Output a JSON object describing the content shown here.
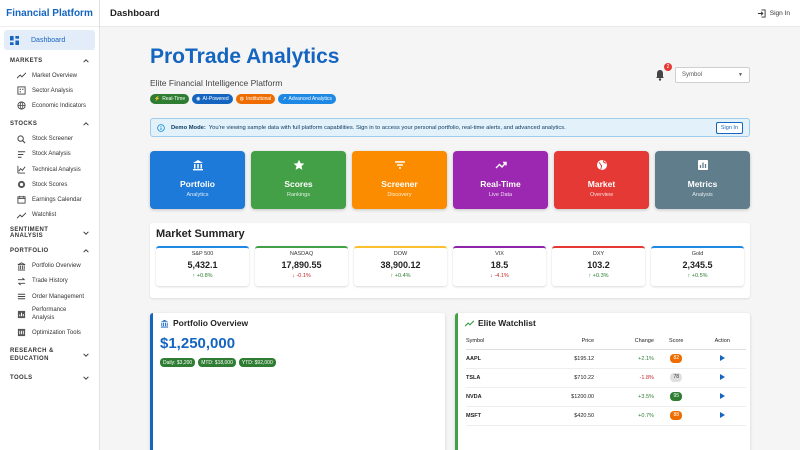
{
  "app": {
    "title": "Financial Platform"
  },
  "sidebar": {
    "active": "Dashboard",
    "sections": [
      {
        "label": "MARKETS",
        "items": [
          "Market Overview",
          "Sector Analysis",
          "Economic Indicators"
        ]
      },
      {
        "label": "STOCKS",
        "items": [
          "Stock Screener",
          "Stock Analysis",
          "Technical Analysis",
          "Stock Scores",
          "Earnings Calendar",
          "Watchlist"
        ]
      },
      {
        "label": "SENTIMENT ANALYSIS",
        "items": []
      },
      {
        "label": "PORTFOLIO",
        "items": [
          "Portfolio Overview",
          "Trade History",
          "Order Management",
          "Performance Analysis",
          "Optimization Tools"
        ]
      },
      {
        "label": "RESEARCH & EDUCATION",
        "items": []
      },
      {
        "label": "TOOLS",
        "items": []
      }
    ]
  },
  "topbar": {
    "title": "Dashboard",
    "signin": "Sign In"
  },
  "hero": {
    "title": "ProTrade Analytics",
    "subtitle": "Elite Financial Intelligence Platform",
    "badges": [
      {
        "label": "Real-Time",
        "color": "#2e7d32"
      },
      {
        "label": "AI-Powered",
        "color": "#1565c0"
      },
      {
        "label": "Institutional",
        "color": "#ef6c00"
      },
      {
        "label": "Advanced Analytics",
        "color": "#1e88e5"
      }
    ],
    "notif_count": "2",
    "symbol_placeholder": "Symbol"
  },
  "alert": {
    "title": "Demo Mode:",
    "text": "You're viewing sample data with full platform capabilities. Sign in to access your personal portfolio, real-time alerts, and advanced analytics.",
    "button": "Sign In"
  },
  "tiles": [
    {
      "title": "Portfolio",
      "sub": "Analytics",
      "color": "#1e7ad9",
      "icon": "bank-icon"
    },
    {
      "title": "Scores",
      "sub": "Rankings",
      "color": "#43a047",
      "icon": "star-icon"
    },
    {
      "title": "Screener",
      "sub": "Discovery",
      "color": "#fb8c00",
      "icon": "filter-icon"
    },
    {
      "title": "Real-Time",
      "sub": "Live Data",
      "color": "#9c27b0",
      "icon": "trending-icon"
    },
    {
      "title": "Market",
      "sub": "Overview",
      "color": "#e53935",
      "icon": "globe-icon"
    },
    {
      "title": "Metrics",
      "sub": "Analysis",
      "color": "#607d8b",
      "icon": "chart-icon"
    }
  ],
  "summary": {
    "title": "Market Summary",
    "cards": [
      {
        "name": "S&P 500",
        "value": "5,432.1",
        "change": "+0.8%",
        "dir": "up",
        "color": "#1e88e5"
      },
      {
        "name": "NASDAQ",
        "value": "17,890.55",
        "change": "-0.1%",
        "dir": "down",
        "color": "#43a047"
      },
      {
        "name": "DOW",
        "value": "38,900.12",
        "change": "+0.4%",
        "dir": "up",
        "color": "#fbc02d"
      },
      {
        "name": "VIX",
        "value": "18.5",
        "change": "-4.1%",
        "dir": "down",
        "color": "#8e24aa"
      },
      {
        "name": "DXY",
        "value": "103.2",
        "change": "+0.3%",
        "dir": "up",
        "color": "#e53935"
      },
      {
        "name": "Gold",
        "value": "2,345.5",
        "change": "+0.5%",
        "dir": "up",
        "color": "#1e88e5"
      }
    ]
  },
  "portfolio": {
    "title": "Portfolio Overview",
    "value": "$1,250,000",
    "chips": [
      "Daily: $3,200",
      "MTD: $18,000",
      "YTD: $92,000"
    ]
  },
  "watchlist": {
    "title": "Elite Watchlist",
    "headers": [
      "Symbol",
      "Price",
      "Change",
      "Score",
      "Action"
    ],
    "rows": [
      {
        "symbol": "AAPL",
        "price": "$195.12",
        "change": "+2.1%",
        "dir": "up",
        "score": "82",
        "score_color": "#ef6c00"
      },
      {
        "symbol": "TSLA",
        "price": "$710.22",
        "change": "-1.8%",
        "dir": "down",
        "score": "78",
        "score_color": "#e0e0e0"
      },
      {
        "symbol": "NVDA",
        "price": "$1200.00",
        "change": "+3.5%",
        "dir": "up",
        "score": "95",
        "score_color": "#2e7d32"
      },
      {
        "symbol": "MSFT",
        "price": "$420.50",
        "change": "+0.7%",
        "dir": "up",
        "score": "88",
        "score_color": "#ef6c00"
      }
    ]
  }
}
